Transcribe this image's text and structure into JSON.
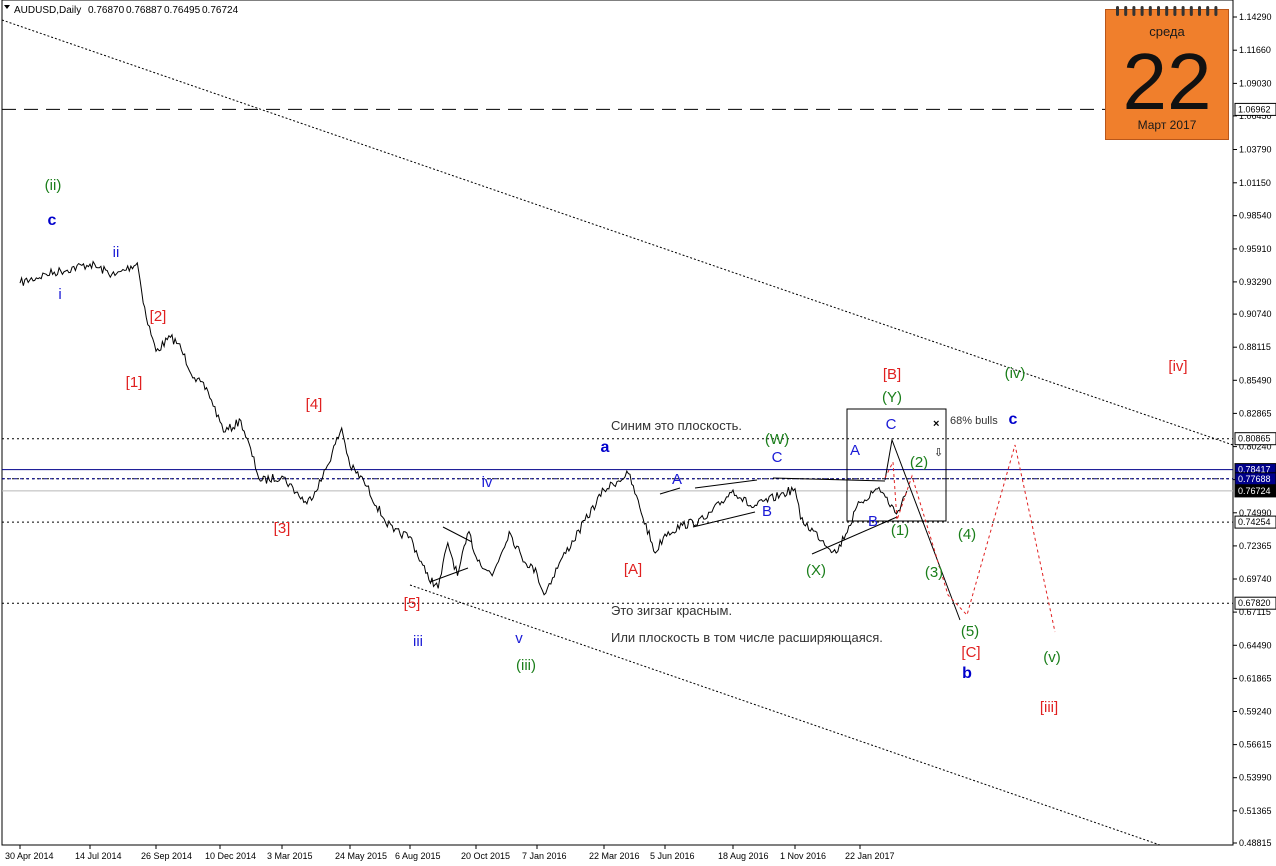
{
  "header": {
    "symbol": "AUDUSD,Daily",
    "open": "0.76870",
    "high": "0.76887",
    "low": "0.76495",
    "close": "0.76724"
  },
  "calendar": {
    "weekday": "среда",
    "day": "22",
    "month_year": "Март 2017"
  },
  "chart_data": {
    "type": "line",
    "symbol": "AUDUSD",
    "timeframe": "Daily",
    "x_tick_labels": [
      "30 Apr 2014",
      "14 Jul 2014",
      "26 Sep 2014",
      "10 Dec 2014",
      "3 Mar 2015",
      "24 May 2015",
      "6 Aug 2015",
      "20 Oct 2015",
      "7 Jan 2016",
      "22 Mar 2016",
      "5 Jun 2016",
      "18 Aug 2016",
      "1 Nov 2016",
      "22 Jan 2017"
    ],
    "y_tick_labels": [
      "1.14290",
      "1.11660",
      "1.09030",
      "1.06450",
      "1.03790",
      "1.01150",
      "0.98540",
      "0.95910",
      "0.93290",
      "0.90740",
      "0.88115",
      "0.85490",
      "0.82865",
      "0.80240",
      "0.77620",
      "0.74990",
      "0.72365",
      "0.69740",
      "0.67115",
      "0.64490",
      "0.61865",
      "0.59240",
      "0.56615",
      "0.53990",
      "0.51365",
      "0.48815"
    ],
    "ylim": [
      0.488,
      1.143
    ],
    "series": [
      {
        "values": [
          [
            "30 Apr 2014",
            0.932
          ],
          [
            "28 May 2014",
            0.939
          ],
          [
            "14 Jul 2014",
            0.947
          ],
          [
            "11 Aug 2014",
            0.938
          ],
          [
            "5 Sep 2014",
            0.948
          ],
          [
            "15 Sep 2014",
            0.905
          ],
          [
            "26 Sep 2014",
            0.878
          ],
          [
            "13 Oct 2014",
            0.889
          ],
          [
            "22 Oct 2014",
            0.884
          ],
          [
            "10 Nov 2014",
            0.857
          ],
          [
            "26 Nov 2014",
            0.846
          ],
          [
            "10 Dec 2014",
            0.822
          ],
          [
            "17 Dec 2014",
            0.814
          ],
          [
            "7 Jan 2015",
            0.823
          ],
          [
            "2 Feb 2015",
            0.775
          ],
          [
            "3 Mar 2015",
            0.779
          ],
          [
            "2 Apr 2015",
            0.757
          ],
          [
            "21 Apr 2015",
            0.778
          ],
          [
            "14 May 2015",
            0.817
          ],
          [
            "24 May 2015",
            0.787
          ],
          [
            "10 Jun 2015",
            0.775
          ],
          [
            "5 Jul 2015",
            0.745
          ],
          [
            "17 Jul 2015",
            0.735
          ],
          [
            "6 Aug 2015",
            0.731
          ],
          [
            "24 Aug 2015",
            0.702
          ],
          [
            "7 Sep 2015",
            0.69
          ],
          [
            "18 Sep 2015",
            0.726
          ],
          [
            "29 Sep 2015",
            0.7
          ],
          [
            "12 Oct 2015",
            0.735
          ],
          [
            "20 Oct 2015",
            0.715
          ],
          [
            "10 Nov 2015",
            0.7
          ],
          [
            "2 Dec 2015",
            0.735
          ],
          [
            "18 Dec 2015",
            0.715
          ],
          [
            "7 Jan 2016",
            0.702
          ],
          [
            "15 Jan 2016",
            0.685
          ],
          [
            "1 Feb 2016",
            0.71
          ],
          [
            "22 Mar 2016",
            0.768
          ],
          [
            "21 Apr 2016",
            0.781
          ],
          [
            "5 May 2016",
            0.754
          ],
          [
            "24 May 2016",
            0.718
          ],
          [
            "5 Jun 2016",
            0.733
          ],
          [
            "24 Jun 2016",
            0.74
          ],
          [
            "19 Jul 2016",
            0.745
          ],
          [
            "18 Aug 2016",
            0.768
          ],
          [
            "10 Sep 2016",
            0.754
          ],
          [
            "14 Oct 2016",
            0.764
          ],
          [
            "1 Nov 2016",
            0.769
          ],
          [
            "8 Nov 2016",
            0.745
          ],
          [
            "23 Dec 2016",
            0.718
          ],
          [
            "22 Jan 2017",
            0.758
          ],
          [
            "15 Feb 2017",
            0.77
          ],
          [
            "9 Mar 2017",
            0.749
          ],
          [
            "22 Mar 2017",
            0.767
          ]
        ]
      }
    ],
    "horizontal_levels": [
      "1.06962",
      "0.80865",
      "0.78417",
      "0.77688",
      "0.76724",
      "0.74254",
      "0.67820"
    ],
    "level_colors": {
      "dashed": "#000000",
      "blue": "#00008b",
      "close": "#888888"
    },
    "wave_label_colors": {
      "green": "#1a7e1a",
      "blue": "#1a1ad6",
      "red": "#e02020",
      "darkblue": "#0000cc"
    },
    "labels": [
      {
        "text": "(ii)",
        "color": "green"
      },
      {
        "text": "c",
        "color": "darkblue"
      },
      {
        "text": "ii",
        "color": "blue"
      },
      {
        "text": "i",
        "color": "blue"
      },
      {
        "text": "[2]",
        "color": "red"
      },
      {
        "text": "[1]",
        "color": "red"
      },
      {
        "text": "[4]",
        "color": "red"
      },
      {
        "text": "[3]",
        "color": "red"
      },
      {
        "text": "[5]",
        "color": "red"
      },
      {
        "text": "iii",
        "color": "blue"
      },
      {
        "text": "iv",
        "color": "blue"
      },
      {
        "text": "v",
        "color": "blue"
      },
      {
        "text": "(iii)",
        "color": "green"
      },
      {
        "text": "a",
        "color": "darkblue"
      },
      {
        "text": "[A]",
        "color": "red"
      },
      {
        "text": "A",
        "color": "blue"
      },
      {
        "text": "B",
        "color": "blue"
      },
      {
        "text": "C",
        "color": "blue"
      },
      {
        "text": "(W)",
        "color": "green"
      },
      {
        "text": "(X)",
        "color": "green"
      },
      {
        "text": "[B]",
        "color": "red"
      },
      {
        "text": "(Y)",
        "color": "green"
      },
      {
        "text": "A",
        "color": "blue"
      },
      {
        "text": "C",
        "color": "blue"
      },
      {
        "text": "B",
        "color": "blue"
      },
      {
        "text": "(1)",
        "color": "green"
      },
      {
        "text": "(2)",
        "color": "green"
      },
      {
        "text": "(3)",
        "color": "green"
      },
      {
        "text": "(4)",
        "color": "green"
      },
      {
        "text": "(5)",
        "color": "green"
      },
      {
        "text": "[C]",
        "color": "red"
      },
      {
        "text": "b",
        "color": "darkblue"
      },
      {
        "text": "c",
        "color": "darkblue"
      },
      {
        "text": "(iv)",
        "color": "green"
      },
      {
        "text": "[iv]",
        "color": "red"
      },
      {
        "text": "(v)",
        "color": "green"
      },
      {
        "text": "[iii]",
        "color": "red"
      }
    ],
    "annotations": [
      "Синим это плоскость.",
      "Это зигзаг красным.",
      "Или плоскость в том числе расширяющаяся.",
      "68% bulls"
    ]
  }
}
